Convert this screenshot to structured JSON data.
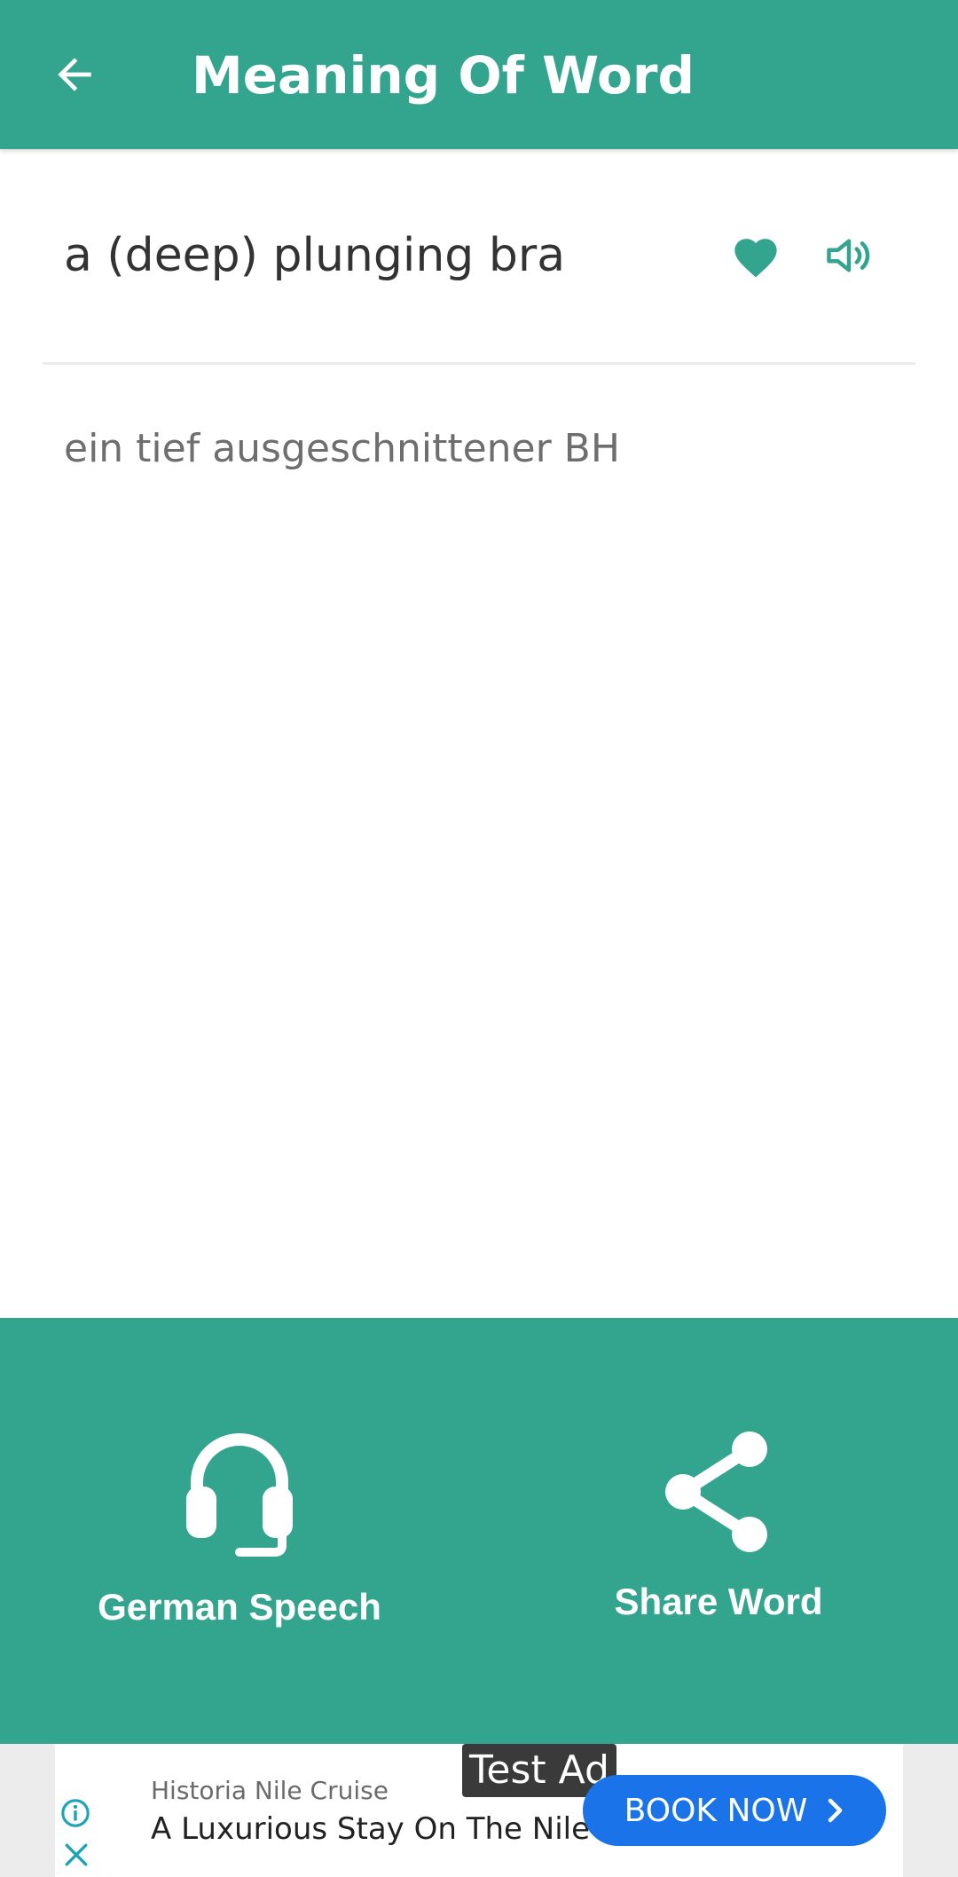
{
  "app_bar": {
    "title": "Meaning Of Word",
    "back_icon": "arrow-left-icon",
    "background": "#33a58e"
  },
  "entry": {
    "word": "a (deep) plunging bra",
    "favorite_icon": "heart-icon",
    "speak_icon": "speaker-icon",
    "translation": "ein tief ausgeschnittener BH"
  },
  "actions": [
    {
      "label": "German Speech",
      "icon": "headset-icon"
    },
    {
      "label": "Share Word",
      "icon": "share-icon"
    }
  ],
  "ad": {
    "badge": "Test Ad",
    "advertiser": "Historia Nile Cruise",
    "headline": "A Luxurious Stay On The Nile",
    "cta": "BOOK NOW",
    "cta_color": "#1a73e8",
    "info_icon": "info-icon",
    "close_icon": "close-icon"
  },
  "colors": {
    "accent": "#33a58e",
    "word_text": "#333333",
    "translation_text": "#6e6e6e"
  }
}
